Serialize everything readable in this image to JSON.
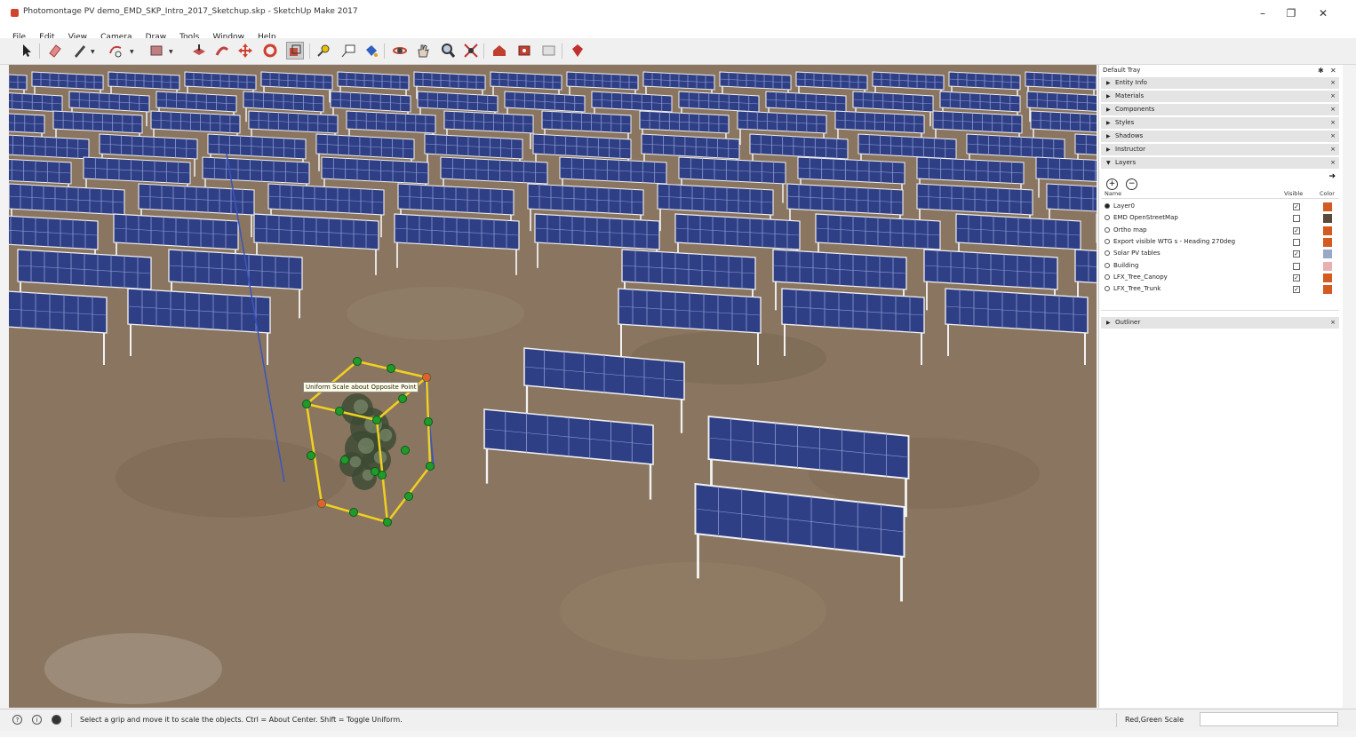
{
  "window": {
    "title": "Photomontage PV demo_EMD_SKP_Intro_2017_Sketchup.skp - SketchUp Make 2017",
    "controls": {
      "minimize": "–",
      "restore": "❐",
      "close": "✕"
    }
  },
  "menu": [
    "File",
    "Edit",
    "View",
    "Camera",
    "Draw",
    "Tools",
    "Window",
    "Help"
  ],
  "toolbar": {
    "tools": [
      "select",
      "eraser",
      "line",
      "arc",
      "rectangle",
      "push-pull",
      "move",
      "rotate",
      "scale",
      "tape-measure",
      "text",
      "paint-bucket",
      "orbit",
      "pan",
      "zoom",
      "zoom-extents",
      "3d-warehouse",
      "extension-warehouse",
      "layout",
      "send-to-layout"
    ],
    "active_tool": "scale"
  },
  "viewport": {
    "tooltip": "Uniform Scale about Opposite Point",
    "colors": {
      "ground": "#8a7560",
      "panel": "#2f3f86",
      "panel_grid": "#8e9ad0",
      "post": "#f2f2f2",
      "bbox": "#f0d020",
      "grip": "#1e9b2a",
      "grip_corner": "#e06030",
      "axis": "#3a55c0"
    }
  },
  "tray": {
    "title": "Default Tray",
    "panels": [
      "Entity Info",
      "Materials",
      "Components",
      "Styles",
      "Shadows",
      "Instructor",
      "Layers"
    ],
    "layers": {
      "columns": {
        "name": "Name",
        "visible": "Visible",
        "color": "Color"
      },
      "rows": [
        {
          "name": "Layer0",
          "active": true,
          "visible": true,
          "color": "#d45a22"
        },
        {
          "name": "EMD OpenStreetMap",
          "active": false,
          "visible": false,
          "color": "#5a4a3a"
        },
        {
          "name": "Ortho map",
          "active": false,
          "visible": true,
          "color": "#d45a22"
        },
        {
          "name": "Export visible WTG s - Heading 270deg",
          "active": false,
          "visible": false,
          "color": "#d45a22"
        },
        {
          "name": "Solar PV tables",
          "active": false,
          "visible": true,
          "color": "#9aa8c8"
        },
        {
          "name": "Building",
          "active": false,
          "visible": false,
          "color": "#e8b0b0"
        },
        {
          "name": "LFX_Tree_Canopy",
          "active": false,
          "visible": true,
          "color": "#d45a22"
        },
        {
          "name": "LFX_Tree_Trunk",
          "active": false,
          "visible": true,
          "color": "#d45a22"
        }
      ]
    },
    "outliner": "Outliner"
  },
  "statusbar": {
    "message": "Select a grip and move it to scale the objects. Ctrl = About Center. Shift = Toggle Uniform.",
    "vcb_label": "Red,Green Scale",
    "vcb_value": ""
  }
}
